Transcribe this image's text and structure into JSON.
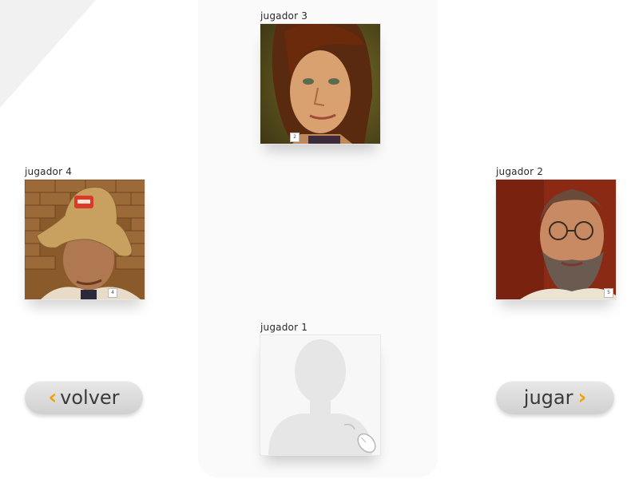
{
  "players": [
    {
      "id": "p1",
      "label": "jugador 1",
      "badge": ""
    },
    {
      "id": "p2",
      "label": "jugador 2",
      "badge": "5"
    },
    {
      "id": "p3",
      "label": "jugador 3",
      "badge": "2"
    },
    {
      "id": "p4",
      "label": "jugador 4",
      "badge": "4"
    }
  ],
  "buttons": {
    "back_label": "volver",
    "play_label": "jugar"
  },
  "icons": {
    "back": "chevron-left-icon",
    "play": "chevron-right-icon",
    "mouse": "mouse-icon"
  },
  "colors": {
    "accent": "#f0a200",
    "button": "#dcdcdc",
    "panel": "#fafafa"
  }
}
